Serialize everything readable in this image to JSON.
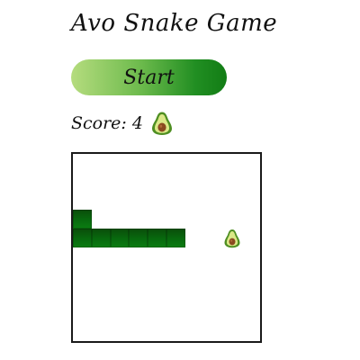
{
  "title": "Avo Snake Game",
  "start_button": {
    "label": "Start"
  },
  "score": {
    "label": "Score:",
    "value": "4",
    "icon": "avocado-icon"
  },
  "board": {
    "grid_columns": 10,
    "grid_rows": 10,
    "snake": [
      [
        0,
        3
      ],
      [
        0,
        4
      ],
      [
        1,
        4
      ],
      [
        2,
        4
      ],
      [
        3,
        4
      ],
      [
        4,
        4
      ],
      [
        5,
        4
      ]
    ],
    "food": {
      "cell": [
        8,
        4
      ],
      "icon": "avocado-icon"
    }
  },
  "colors": {
    "snake": "#086a0e",
    "button_start": "#b5dc7e",
    "button_end": "#127d15",
    "border": "#1a1a1a"
  }
}
